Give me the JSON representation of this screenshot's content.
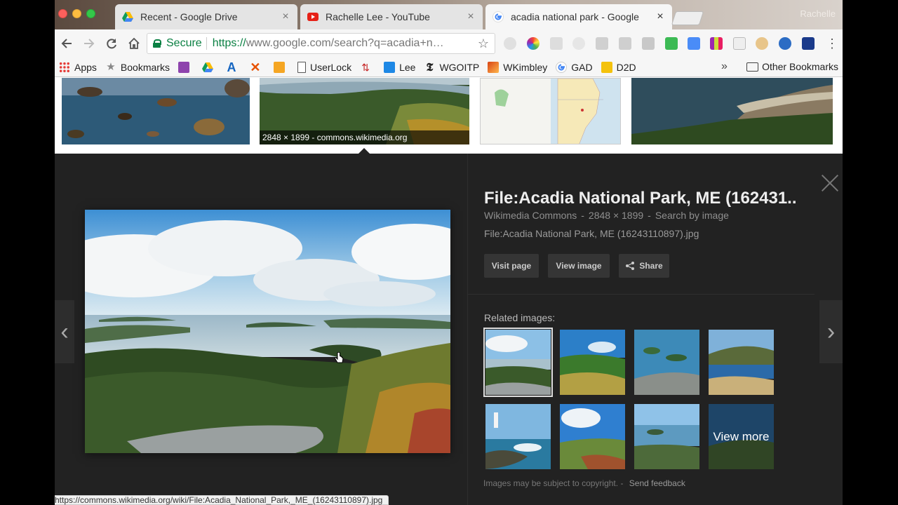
{
  "browser": {
    "profile_name": "Rachelle",
    "tabs": [
      {
        "label": "Recent - Google Drive",
        "icon": "google-drive-icon",
        "close": "×"
      },
      {
        "label": "Rachelle Lee - YouTube",
        "icon": "youtube-icon",
        "close": "×"
      },
      {
        "label": "acadia national park - Google",
        "icon": "google-icon",
        "close": "×"
      }
    ],
    "omnibox": {
      "secure_label": "Secure",
      "url_prefix": "https://",
      "url_rest": "www.google.com/search?q=acadia+n…"
    },
    "bookmarks": [
      {
        "label": "Apps",
        "icon": "apps-grid-icon"
      },
      {
        "label": "Bookmarks",
        "icon": "star-icon"
      },
      {
        "label": "",
        "icon": "purple-extension-icon"
      },
      {
        "label": "",
        "icon": "google-drive-icon"
      },
      {
        "label": "",
        "icon": "a-logo-icon"
      },
      {
        "label": "",
        "icon": "x-tool-icon"
      },
      {
        "label": "",
        "icon": "orange-app-icon"
      },
      {
        "label": "UserLock",
        "icon": "page-icon"
      },
      {
        "label": "",
        "icon": "arrows-icon"
      },
      {
        "label": "Lee",
        "icon": "calendar-icon"
      },
      {
        "label": "WGOITP",
        "icon": "nyt-icon"
      },
      {
        "label": "WKimbley",
        "icon": "photo-icon"
      },
      {
        "label": "GAD",
        "icon": "google-icon"
      },
      {
        "label": "D2D",
        "icon": "yellow-folder-icon"
      }
    ],
    "more_chevron": "»",
    "other_bookmarks": "Other Bookmarks",
    "status_url": "https://commons.wikimedia.org/wiki/File:Acadia_National_Park,_ME_(16243110897).jpg"
  },
  "results": {
    "top_thumb_caption": "2848 × 1899 - commons.wikimedia.org"
  },
  "panel": {
    "title": "File:Acadia National Park, ME (162431..",
    "source": "Wikimedia Commons",
    "dimensions": "2848 × 1899",
    "search_by_image": "Search by image",
    "separator": "-",
    "filename": "File:Acadia National Park, ME (16243110897).jpg",
    "buttons": {
      "visit": "Visit page",
      "view": "View image",
      "share": "Share"
    },
    "related_label": "Related images:",
    "view_more": "View more",
    "copyright": "Images may be subject to copyright.",
    "feedback": "Send feedback",
    "prev_arrow": "‹",
    "next_arrow": "›"
  }
}
